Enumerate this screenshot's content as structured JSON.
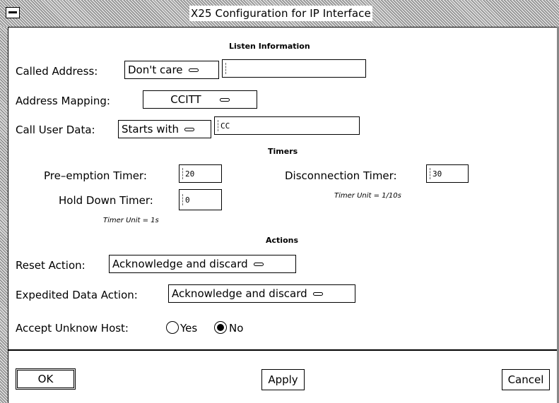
{
  "window": {
    "title": "X25 Configuration for IP Interface"
  },
  "listen": {
    "heading": "Listen Information",
    "called_address": {
      "label": "Called Address:",
      "menu": "Don't care",
      "value": ""
    },
    "address_mapping": {
      "label": "Address Mapping:",
      "menu": "CCITT"
    },
    "call_user_data": {
      "label": "Call User Data:",
      "menu": "Starts with",
      "value": "CC"
    }
  },
  "timers": {
    "heading": "Timers",
    "preemption": {
      "label": "Pre–emption Timer:",
      "value": "20"
    },
    "hold_down": {
      "label": "Hold Down Timer:",
      "value": "0"
    },
    "disconnection": {
      "label": "Disconnection Timer:",
      "value": "30"
    },
    "unit_left": "Timer Unit = 1s",
    "unit_right": "Timer Unit = 1/10s"
  },
  "actions": {
    "heading": "Actions",
    "reset": {
      "label": "Reset Action:",
      "menu": "Acknowledge and discard"
    },
    "expedited": {
      "label": "Expedited Data Action:",
      "menu": "Acknowledge and discard"
    },
    "accept_unknown": {
      "label": "Accept Unknow Host:",
      "yes": "Yes",
      "no": "No",
      "selected": "No"
    }
  },
  "buttons": {
    "ok": "OK",
    "apply": "Apply",
    "cancel": "Cancel"
  }
}
